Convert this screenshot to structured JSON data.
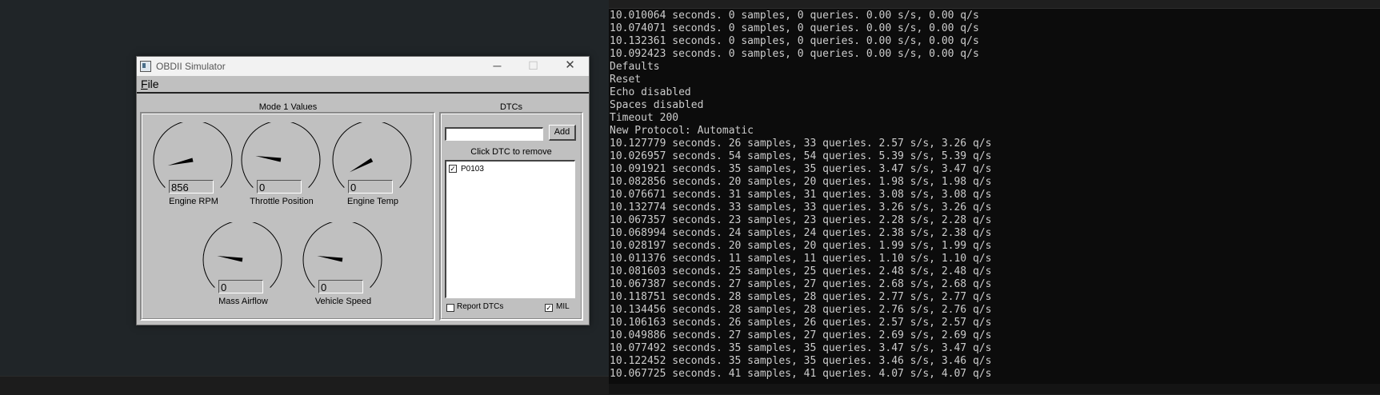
{
  "window": {
    "title": "OBDII Simulator"
  },
  "titlebar": {
    "minimize_glyph": "─",
    "maximize_glyph": "☐",
    "close_glyph": "✕"
  },
  "menu": {
    "file_label": "File",
    "file_mnemonic": "F",
    "file_rest": "ile"
  },
  "mode1": {
    "title": "Mode 1 Values",
    "gauges": [
      {
        "label": "Engine RPM",
        "value": "856",
        "fraction": 0.12
      },
      {
        "label": "Throttle Position",
        "value": "0",
        "fraction": 0.2
      },
      {
        "label": "Engine Temp",
        "value": "0",
        "fraction": 0.06
      },
      {
        "label": "Mass Airflow",
        "value": "0",
        "fraction": 0.2
      },
      {
        "label": "Vehicle Speed",
        "value": "0",
        "fraction": 0.2
      }
    ]
  },
  "dtcs": {
    "title": "DTCs",
    "input_value": "",
    "add_label": "Add",
    "list_hint": "Click DTC to remove",
    "items": [
      {
        "code": "P0103",
        "checked": true
      }
    ],
    "report_label": "Report DTCs",
    "report_checked": false,
    "mil_label": "MIL",
    "mil_checked": true,
    "check_glyph": "✓"
  },
  "terminal": {
    "lines": [
      "10.010064 seconds. 0 samples, 0 queries. 0.00 s/s, 0.00 q/s",
      "10.074071 seconds. 0 samples, 0 queries. 0.00 s/s, 0.00 q/s",
      "10.132361 seconds. 0 samples, 0 queries. 0.00 s/s, 0.00 q/s",
      "10.092423 seconds. 0 samples, 0 queries. 0.00 s/s, 0.00 q/s",
      "Defaults",
      "Reset",
      "Echo disabled",
      "Spaces disabled",
      "Timeout 200",
      "New Protocol: Automatic",
      "10.127779 seconds. 26 samples, 33 queries. 2.57 s/s, 3.26 q/s",
      "10.026957 seconds. 54 samples, 54 queries. 5.39 s/s, 5.39 q/s",
      "10.091921 seconds. 35 samples, 35 queries. 3.47 s/s, 3.47 q/s",
      "10.082856 seconds. 20 samples, 20 queries. 1.98 s/s, 1.98 q/s",
      "10.076671 seconds. 31 samples, 31 queries. 3.08 s/s, 3.08 q/s",
      "10.132774 seconds. 33 samples, 33 queries. 3.26 s/s, 3.26 q/s",
      "10.067357 seconds. 23 samples, 23 queries. 2.28 s/s, 2.28 q/s",
      "10.068994 seconds. 24 samples, 24 queries. 2.38 s/s, 2.38 q/s",
      "10.028197 seconds. 20 samples, 20 queries. 1.99 s/s, 1.99 q/s",
      "10.011376 seconds. 11 samples, 11 queries. 1.10 s/s, 1.10 q/s",
      "10.081603 seconds. 25 samples, 25 queries. 2.48 s/s, 2.48 q/s",
      "10.067387 seconds. 27 samples, 27 queries. 2.68 s/s, 2.68 q/s",
      "10.118751 seconds. 28 samples, 28 queries. 2.77 s/s, 2.77 q/s",
      "10.134456 seconds. 28 samples, 28 queries. 2.76 s/s, 2.76 q/s",
      "10.106163 seconds. 26 samples, 26 queries. 2.57 s/s, 2.57 q/s",
      "10.049886 seconds. 27 samples, 27 queries. 2.69 s/s, 2.69 q/s",
      "10.077492 seconds. 35 samples, 35 queries. 3.47 s/s, 3.47 q/s",
      "10.122452 seconds. 35 samples, 35 queries. 3.46 s/s, 3.46 q/s",
      "10.067725 seconds. 41 samples, 41 queries. 4.07 s/s, 4.07 q/s"
    ]
  }
}
